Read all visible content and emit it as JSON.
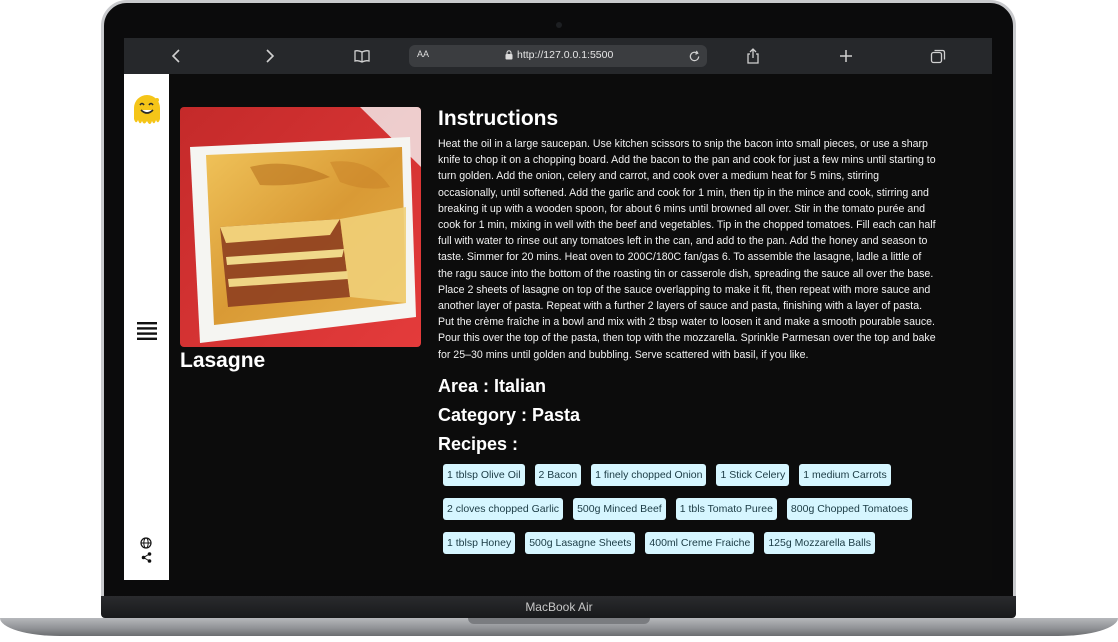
{
  "browser": {
    "url": "http://127.0.0.1:5500",
    "text_size_label": "AA"
  },
  "meal": {
    "name": "Lasagne",
    "instructions_heading": "Instructions",
    "instructions": "Heat the oil in a large saucepan. Use kitchen scissors to snip the bacon into small pieces, or use a sharp knife to chop it on a chopping board. Add the bacon to the pan and cook for just a few mins until starting to turn golden. Add the onion, celery and carrot, and cook over a medium heat for 5 mins, stirring occasionally, until softened. Add the garlic and cook for 1 min, then tip in the mince and cook, stirring and breaking it up with a wooden spoon, for about 6 mins until browned all over. Stir in the tomato purée and cook for 1 min, mixing in well with the beef and vegetables. Tip in the chopped tomatoes. Fill each can half full with water to rinse out any tomatoes left in the can, and add to the pan. Add the honey and season to taste. Simmer for 20 mins. Heat oven to 200C/180C fan/gas 6. To assemble the lasagne, ladle a little of the ragu sauce into the bottom of the roasting tin or casserole dish, spreading the sauce all over the base. Place 2 sheets of lasagne on top of the sauce overlapping to make it fit, then repeat with more sauce and another layer of pasta. Repeat with a further 2 layers of sauce and pasta, finishing with a layer of pasta. Put the crème fraîche in a bowl and mix with 2 tbsp water to loosen it and make a smooth pourable sauce. Pour this over the top of the pasta, then top with the mozzarella. Sprinkle Parmesan over the top and bake for 25–30 mins until golden and bubbling. Serve scattered with basil, if you like.",
    "area_label": "Area : ",
    "area": "Italian",
    "category_label": "Category : ",
    "category": "Pasta",
    "recipes_heading": "Recipes :",
    "ingredients": [
      "1 tblsp Olive Oil",
      "2 Bacon",
      "1 finely chopped Onion",
      "1 Stick Celery",
      "1 medium Carrots",
      "2 cloves chopped Garlic",
      "500g Minced Beef",
      "1 tbls Tomato Puree",
      "800g Chopped Tomatoes",
      "1 tblsp Honey",
      "500g Lasagne Sheets",
      "400ml Creme Fraiche",
      "125g Mozzarella Balls"
    ]
  },
  "laptop": {
    "model_label": "MacBook Air"
  },
  "colors": {
    "tag_bg": "#d6f6ff",
    "page_bg": "#0c0c0c",
    "sidebar_bg": "#ffffff",
    "logo_yellow": "#f5c518"
  },
  "icons": [
    "back-icon",
    "forward-icon",
    "reader-icon",
    "lock-icon",
    "reload-icon",
    "share-icon",
    "new-tab-icon",
    "tabs-icon",
    "logo-icon",
    "menu-icon",
    "globe-icon",
    "share-nodes-icon"
  ]
}
